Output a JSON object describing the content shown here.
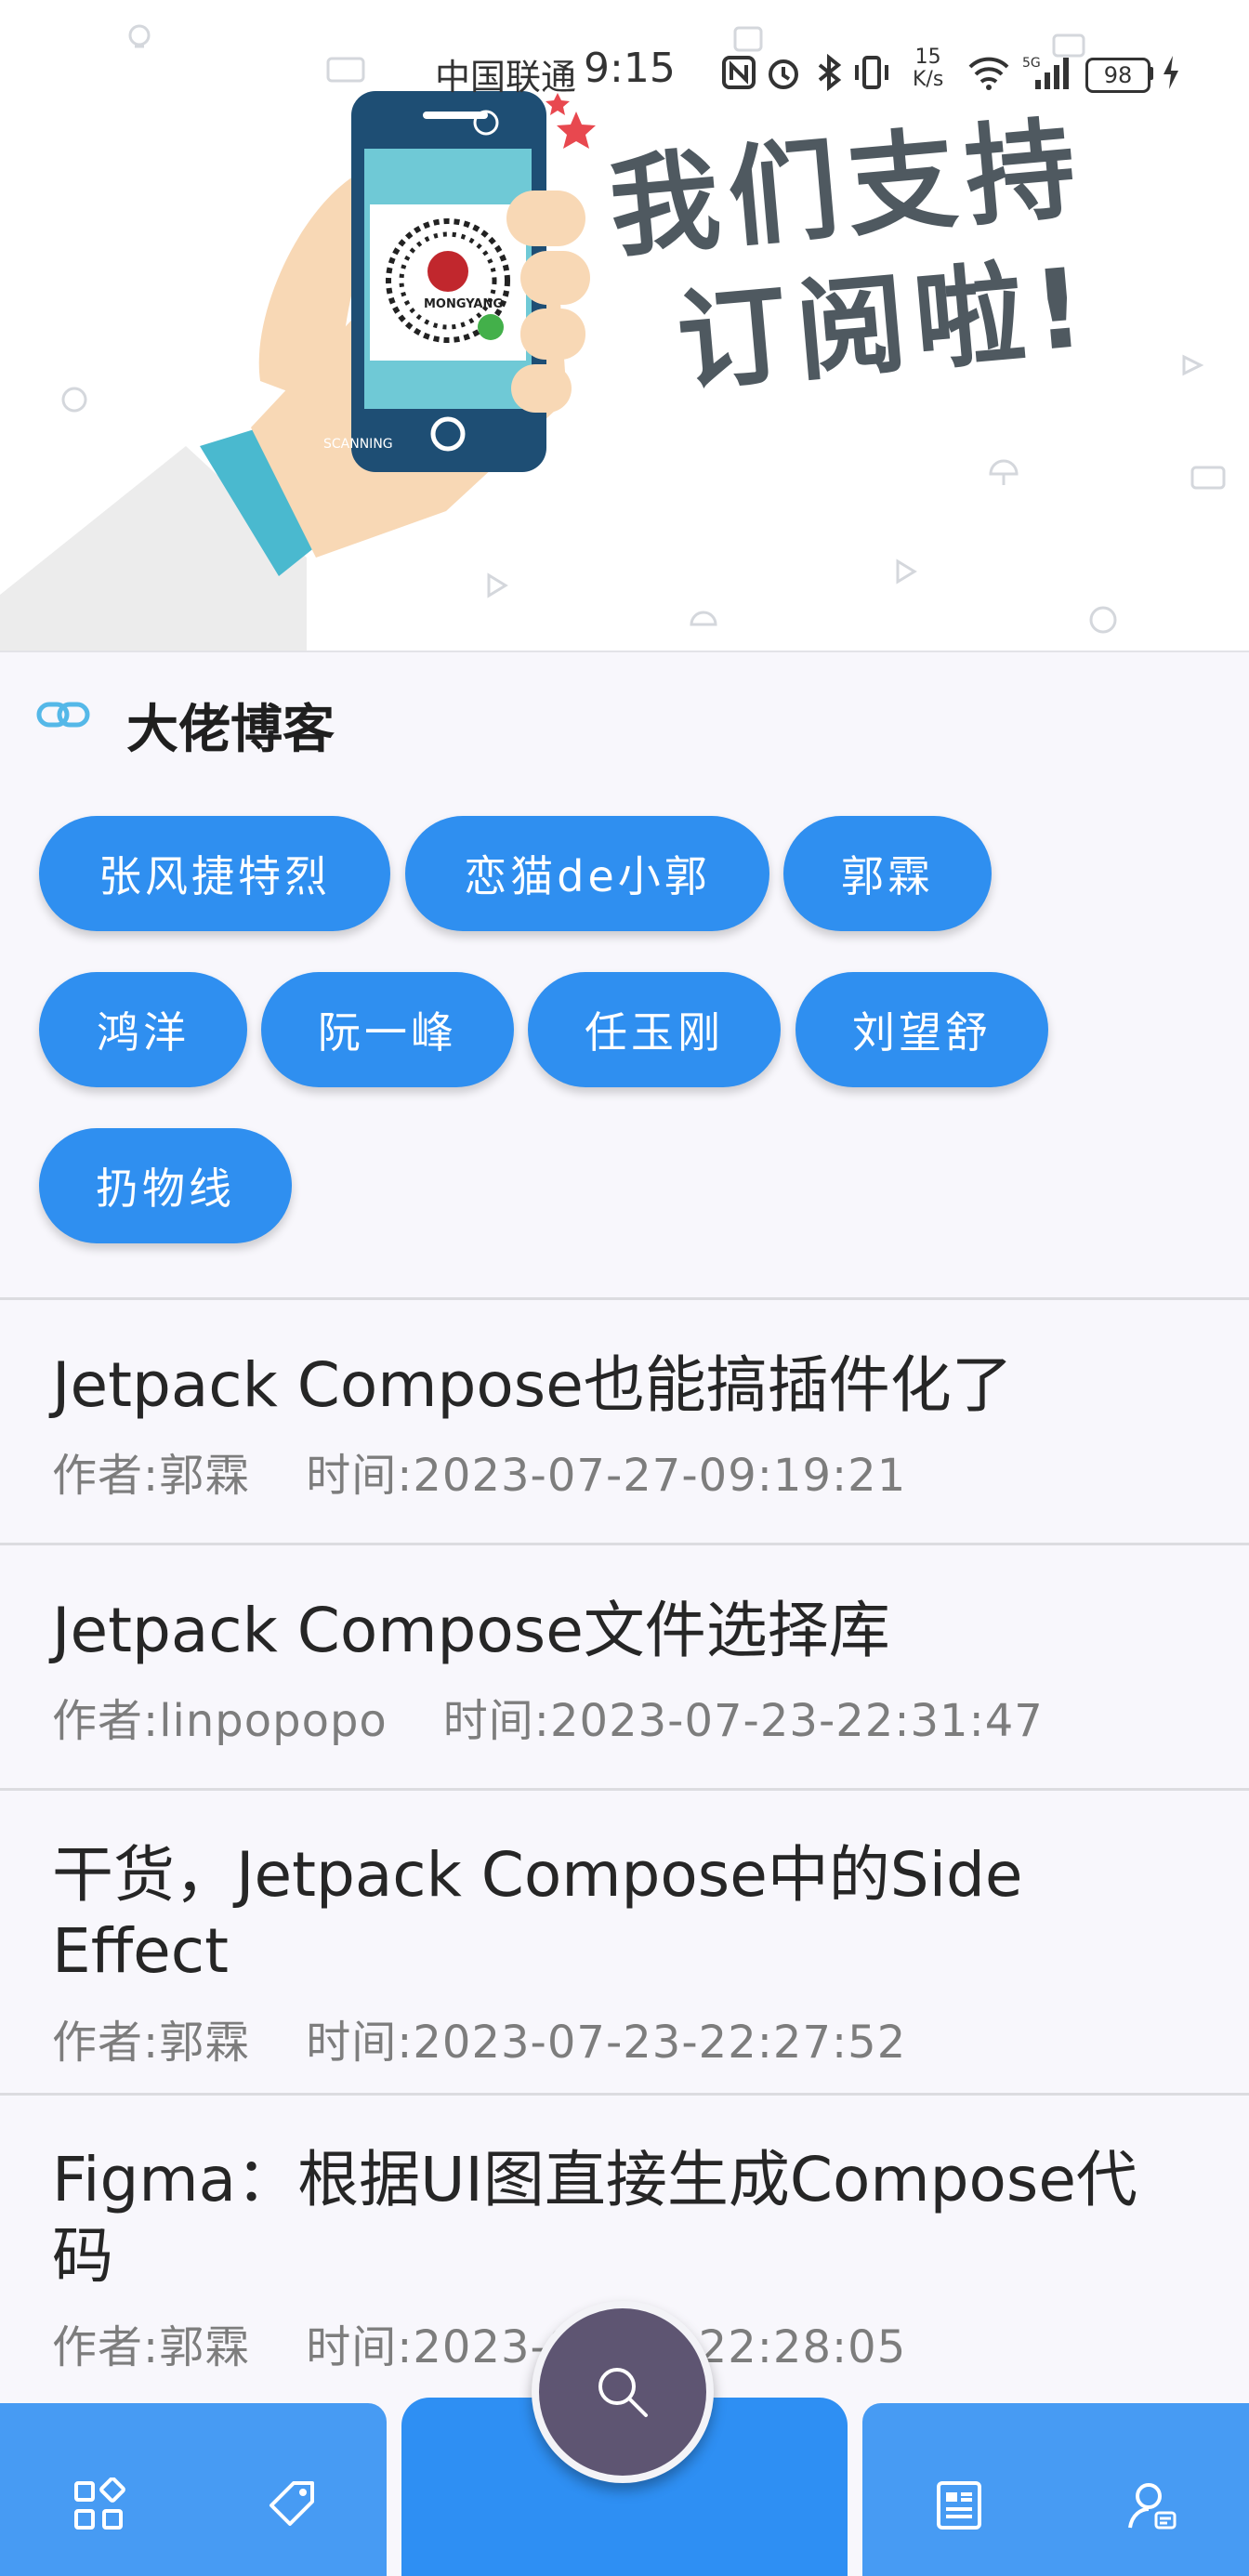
{
  "status_bar": {
    "carrier": "中国联通",
    "time": "9:15",
    "net_speed_value": "15",
    "net_speed_unit": "K/s",
    "battery": "98"
  },
  "banner": {
    "title_line1": "我们支持",
    "title_line2": "订阅啦!",
    "qr_brand": "MONGYANG",
    "phone_caption": "SCANNING"
  },
  "section": {
    "title": "大佬博客"
  },
  "bloggers": [
    "张风捷特烈",
    "恋猫de小郭",
    "郭霖",
    "鸿洋",
    "阮一峰",
    "任玉刚",
    "刘望舒",
    "扔物线"
  ],
  "meta_labels": {
    "author": "作者:",
    "time": "时间:"
  },
  "articles": [
    {
      "title": "Jetpack Compose也能搞插件化了",
      "author": "郭霖",
      "time": "2023-07-27-09:19:21"
    },
    {
      "title": "Jetpack Compose文件选择库",
      "author": "linpopopo",
      "time": "2023-07-23-22:31:47"
    },
    {
      "title": "干货，Jetpack Compose中的Side Effect",
      "author": "郭霖",
      "time": "2023-07-23-22:27:52"
    },
    {
      "title": "Figma：根据UI图直接生成Compose代码",
      "author": "郭霖",
      "time": "2023-07-23-22:28:05"
    }
  ],
  "bottom_nav": {
    "icons": [
      "grid-icon",
      "tag-icon",
      "article-icon",
      "profile-icon"
    ],
    "fab_icon": "search-icon"
  },
  "colors": {
    "chip": "#2f8ff0",
    "nav_side": "#479bf3",
    "nav_center": "#2e8ff3",
    "fab": "#5e5572"
  }
}
